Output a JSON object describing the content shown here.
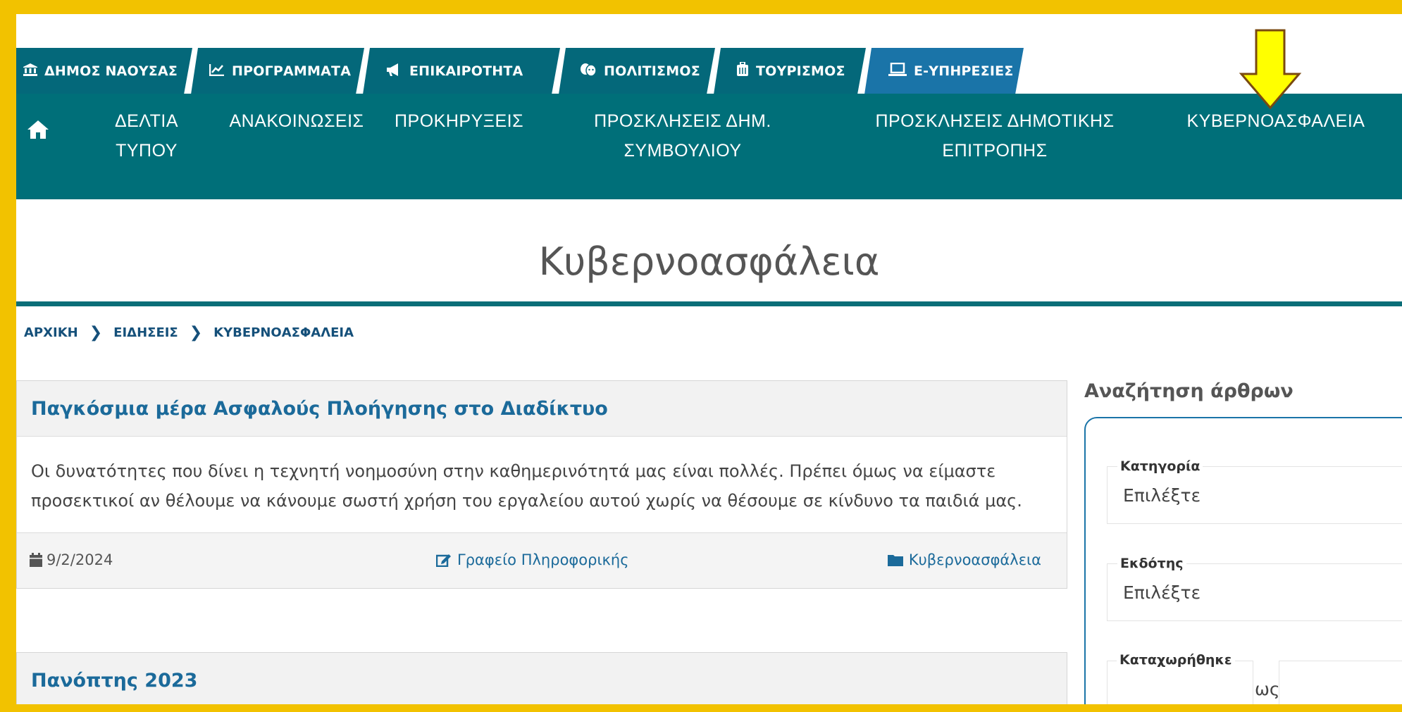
{
  "tabs": [
    {
      "icon": "bank-icon",
      "glyph": "🏛",
      "label": "ΔΗΜΟΣ ΝΑΟΥΣΑΣ"
    },
    {
      "icon": "chart-line-icon",
      "glyph": "📈",
      "label": "ΠΡΟΓΡΑΜΜΑΤΑ"
    },
    {
      "icon": "megaphone-icon",
      "glyph": "📢",
      "label": "ΕΠΙΚΑΙΡΟΤΗΤΑ"
    },
    {
      "icon": "theater-masks-icon",
      "glyph": "🎭",
      "label": "ΠΟΛΙΤΙΣΜΟΣ"
    },
    {
      "icon": "suitcase-icon",
      "glyph": "🧳",
      "label": "ΤΟΥΡΙΣΜΟΣ"
    },
    {
      "icon": "laptop-icon",
      "glyph": "💻",
      "label": "E-ΥΠΗΡΕΣΙΕΣ"
    }
  ],
  "nav": {
    "home_icon": "home-icon",
    "items": [
      {
        "line1": "ΔΕΛΤΙΑ",
        "line2": "ΤΥΠΟΥ"
      },
      {
        "line1": "ΑΝΑΚΟΙΝΩΣΕΙΣ",
        "line2": ""
      },
      {
        "line1": "ΠΡΟΚΗΡΥΞΕΙΣ",
        "line2": ""
      },
      {
        "line1": "ΠΡΟΣΚΛΗΣΕΙΣ ΔΗΜ.",
        "line2": "ΣΥΜΒΟΥΛΙΟΥ"
      },
      {
        "line1": "ΠΡΟΣΚΛΗΣΕΙΣ ΔΗΜΟΤΙΚΗΣ",
        "line2": "ΕΠΙΤΡΟΠΗΣ"
      },
      {
        "line1": "ΚΥΒΕΡΝΟΑΣΦΑΛΕΙΑ",
        "line2": ""
      }
    ]
  },
  "page_title": "Κυβερνοασφάλεια",
  "breadcrumb": [
    "ΑΡΧΙΚΗ",
    "ΕΙΔΗΣΕΙΣ",
    "ΚΥΒΕΡΝΟΑΣΦΑΛΕΙΑ"
  ],
  "breadcrumb_sep": "❯",
  "articles": [
    {
      "title": "Παγκόσμια μέρα Ασφαλούς Πλοήγησης στο Διαδίκτυο",
      "body": "Οι δυνατότητες που δίνει η τεχνητή νοημοσύνη στην καθημερινότητά μας είναι πολλές. Πρέπει όμως να είμαστε προσεκτικοί αν θέλουμε να κάνουμε σωστή χρήση του εργαλείου αυτού χωρίς να θέσουμε σε κίνδυνο τα παιδιά μας.",
      "date": "9/2/2024",
      "author": "Γραφείο Πληροφορικής",
      "category": "Κυβερνοασφάλεια"
    },
    {
      "title": "Πανόπτης 2023"
    }
  ],
  "sidebar": {
    "title": "Αναζήτηση άρθρων",
    "category_label": "Κατηγορία",
    "category_value": "Επιλέξτε",
    "publisher_label": "Εκδότης",
    "publisher_value": "Επιλέξτε",
    "registered_label": "Καταχωρήθηκε",
    "to_label": "ως"
  },
  "colors": {
    "frame": "#f2c200",
    "nav": "#006f79",
    "tab_dark": "#04687a",
    "tab_blue": "#1a74a8",
    "arrow": "#ffff00"
  }
}
